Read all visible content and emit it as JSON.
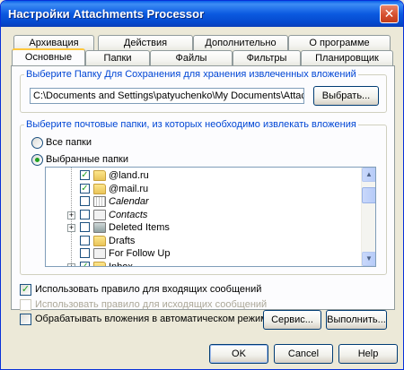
{
  "window": {
    "title": "Настройки Attachments Processor"
  },
  "tabs_back": [
    "Архивация",
    "Действия",
    "Дополнительно",
    "О программе"
  ],
  "tabs_front": [
    "Основные",
    "Папки",
    "Файлы",
    "Фильтры",
    "Планировщик"
  ],
  "active_tab": "Основные",
  "save_group": {
    "caption": "Выберите Папку Для Сохранения для хранения извлеченных вложений",
    "path_value": "C:\\Documents and Settings\\patyuchenko\\My Documents\\Attachments\\",
    "browse_label": "Выбрать..."
  },
  "folders_group": {
    "caption": "Выберите почтовые папки, из которых необходимо извлекать вложения",
    "radio_all": "Все папки",
    "radio_selected": "Выбранные папки",
    "selected_mode": "selected",
    "tree_items": [
      {
        "label": "@land.ru",
        "checked": true,
        "icon": "folder-icon",
        "expander": "",
        "italic": false
      },
      {
        "label": "@mail.ru",
        "checked": true,
        "icon": "folder-icon",
        "expander": "",
        "italic": false
      },
      {
        "label": "Calendar",
        "checked": false,
        "icon": "calendar-icon",
        "expander": "",
        "italic": true
      },
      {
        "label": "Contacts",
        "checked": false,
        "icon": "contacts-icon",
        "expander": "+",
        "italic": true
      },
      {
        "label": "Deleted Items",
        "checked": false,
        "icon": "deleted-items-icon",
        "expander": "+",
        "italic": false
      },
      {
        "label": "Drafts",
        "checked": false,
        "icon": "drafts-icon",
        "expander": "",
        "italic": false
      },
      {
        "label": "For Follow Up",
        "checked": false,
        "icon": "search-folder-icon",
        "expander": "",
        "italic": false
      },
      {
        "label": "Inbox",
        "checked": true,
        "icon": "inbox-icon",
        "expander": "+",
        "italic": false
      }
    ]
  },
  "options": {
    "incoming_rule": {
      "label": "Использовать правило для входящих сообщений",
      "checked": true
    },
    "outgoing_rule": {
      "label": "Использовать правило для исходящих сообщений",
      "checked": false,
      "disabled": true
    },
    "auto_mode": {
      "label": "Обрабатывать вложения в автоматическом режиме",
      "checked": false
    }
  },
  "buttons": {
    "service": "Сервис...",
    "run": "Выполнить...",
    "ok": "OK",
    "cancel": "Cancel",
    "help": "Help"
  },
  "colors": {
    "title_blue": "#0b5ae0",
    "caption_blue": "#0046d5",
    "check_green": "#21a121"
  }
}
